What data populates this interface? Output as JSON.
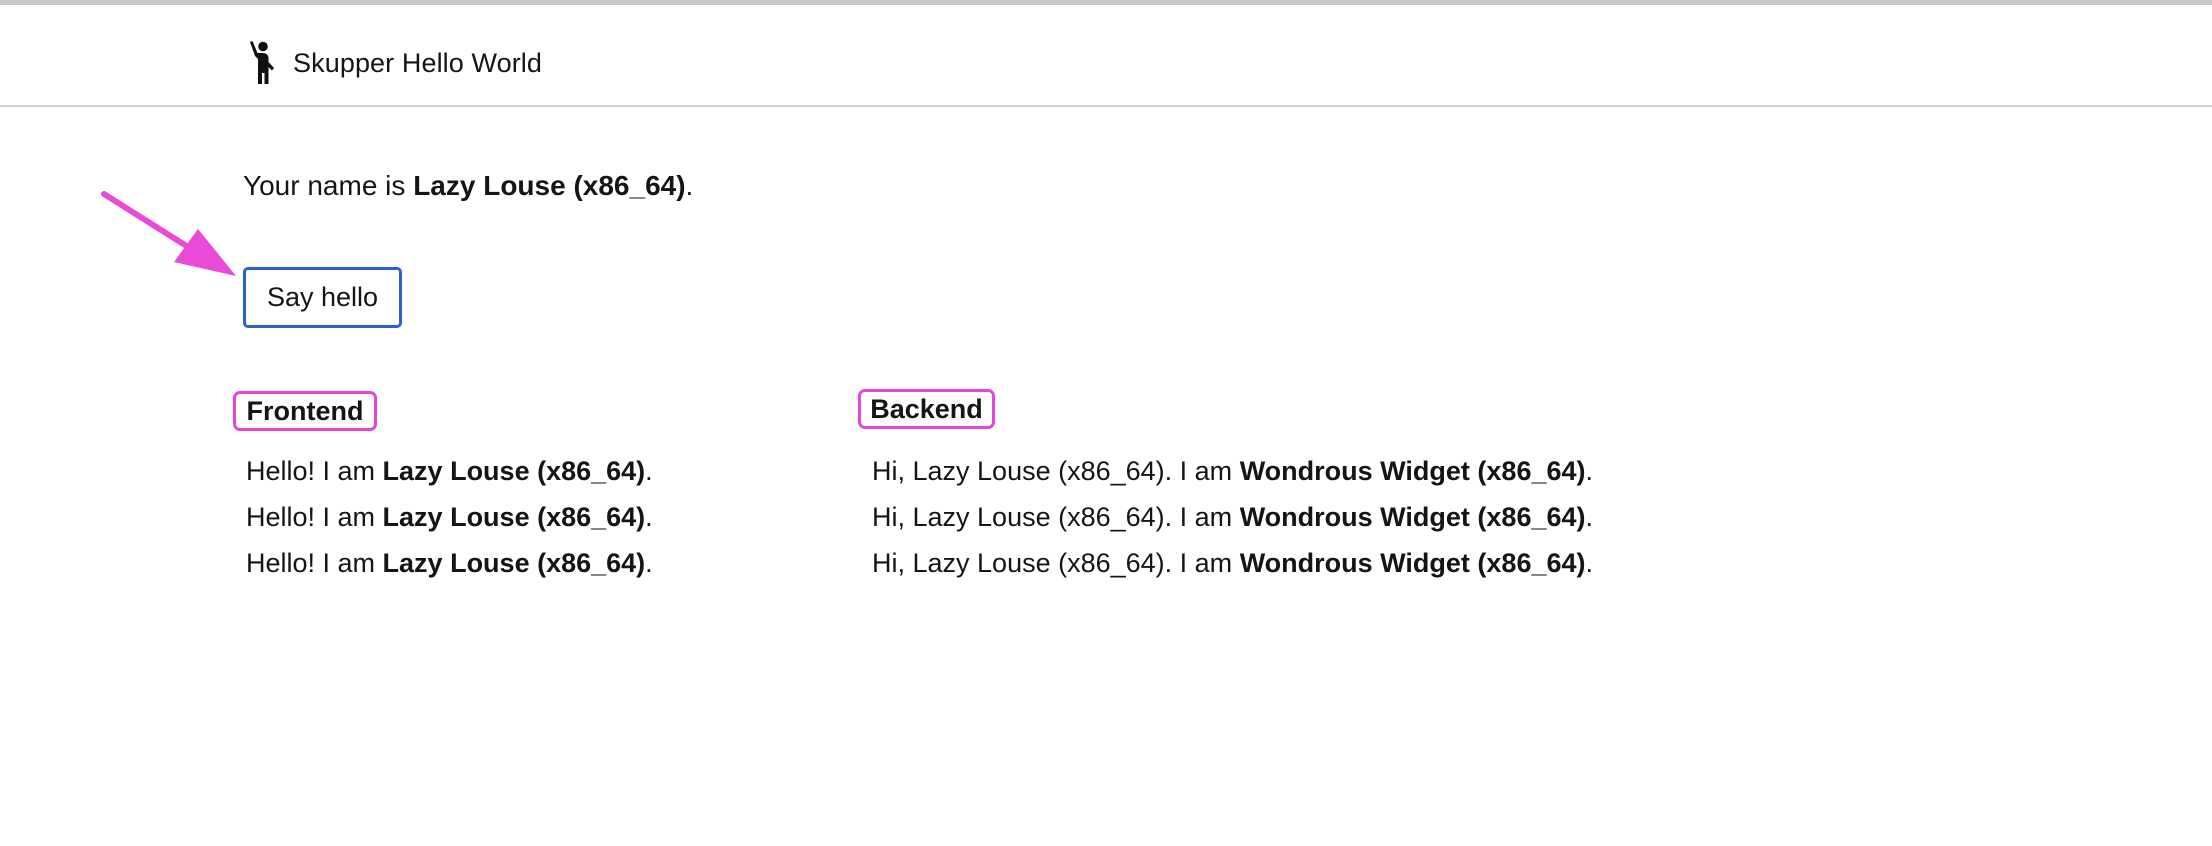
{
  "header": {
    "title": "Skupper Hello World",
    "icon": "person-waving-icon"
  },
  "name_line": {
    "prefix": "Your name is ",
    "name": "Lazy Louse (x86_64)",
    "suffix": "."
  },
  "hello_button": {
    "label": "Say hello"
  },
  "annotation": {
    "arrow_color": "#e94ad8",
    "highlight_color": "#e646d8"
  },
  "frontend": {
    "heading": "Frontend",
    "items": [
      {
        "prefix": "Hello! I am ",
        "name": "Lazy Louse (x86_64)",
        "suffix": "."
      },
      {
        "prefix": "Hello! I am ",
        "name": "Lazy Louse (x86_64)",
        "suffix": "."
      },
      {
        "prefix": "Hello! I am ",
        "name": "Lazy Louse (x86_64)",
        "suffix": "."
      }
    ]
  },
  "backend": {
    "heading": "Backend",
    "items": [
      {
        "prefix": "Hi, Lazy Louse (x86_64). I am ",
        "name": "Wondrous Widget (x86_64)",
        "suffix": "."
      },
      {
        "prefix": "Hi, Lazy Louse (x86_64). I am ",
        "name": "Wondrous Widget (x86_64)",
        "suffix": "."
      },
      {
        "prefix": "Hi, Lazy Louse (x86_64). I am ",
        "name": "Wondrous Widget (x86_64)",
        "suffix": "."
      }
    ]
  },
  "colors": {
    "button_border": "#2b63c8",
    "text": "#151515",
    "header_rule": "#cfcfcf"
  }
}
